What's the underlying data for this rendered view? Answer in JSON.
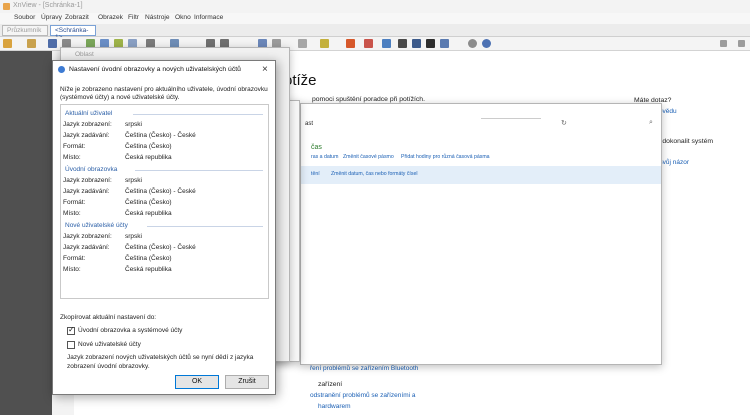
{
  "app": {
    "title": "XnView - [Schránka-1]"
  },
  "menu": [
    "Soubor",
    "Úpravy",
    "Zobrazit",
    "Obrazek",
    "Filtr",
    "Nástroje",
    "Okno",
    "Informace"
  ],
  "tabs": [
    "Průzkumník",
    "<Schránka-1>"
  ],
  "behind": {
    "heading": "otíže",
    "subtitle": "pomoci spuštění poradce při potížích.",
    "question": "Máte dotaz?",
    "help_link": "nápovědu",
    "improve": "zdokonalit systém",
    "feedback_link": "n svůj názor",
    "inner_label_1": "čas",
    "inner_links_1": [
      "ras a datum",
      "Změnit časové pásmo",
      "Přidat hodiny pro různá časová pásma"
    ],
    "inner_links_2": [
      "tění",
      "Změnit datum, čas nebo formáty čísel"
    ],
    "bottom_1": "ření problémů se zařízením Bluetooth",
    "bottom_2": "zařízení",
    "bottom_3": "odstranění problémů se zařízeními a",
    "bottom_4": "hardwarem",
    "mid_dialog_label": "ast",
    "hidden_title": "Oblast"
  },
  "dialog": {
    "title": "Nastavení úvodní obrazovky a nových uživatelských účtů",
    "intro": "Níže je zobrazeno nastavení pro aktuálního uživatele, úvodní obrazovku (systémové účty) a nové uživatelské účty.",
    "sections": [
      {
        "name": "Aktuální uživatel",
        "rows": [
          {
            "label": "Jazyk zobrazení:",
            "value": "srpski"
          },
          {
            "label": "Jazyk zadávání:",
            "value": "Čeština (Česko) - České"
          },
          {
            "label": "Formát:",
            "value": "Čeština (Česko)"
          },
          {
            "label": "Místo:",
            "value": "Česká republika"
          }
        ]
      },
      {
        "name": "Úvodní obrazovka",
        "rows": [
          {
            "label": "Jazyk zobrazení:",
            "value": "srpski"
          },
          {
            "label": "Jazyk zadávání:",
            "value": "Čeština (Česko) - České"
          },
          {
            "label": "Formát:",
            "value": "Čeština (Česko)"
          },
          {
            "label": "Místo:",
            "value": "Česká republika"
          }
        ]
      },
      {
        "name": "Nové uživatelské účty",
        "rows": [
          {
            "label": "Jazyk zobrazení:",
            "value": "srpski"
          },
          {
            "label": "Jazyk zadávání:",
            "value": "Čeština (Česko) - České"
          },
          {
            "label": "Formát:",
            "value": "Čeština (Česko)"
          },
          {
            "label": "Místo:",
            "value": "Česká republika"
          }
        ]
      }
    ],
    "copy_label": "Zkopírovat aktuální nastavení do:",
    "check_welcome": "Úvodní obrazovka a systémové účty",
    "check_welcome_checked": true,
    "check_new": "Nové uživatelské účty",
    "check_new_checked": false,
    "note": "Jazyk zobrazení nových uživatelských účtů se nyní dědí z jazyka zobrazení úvodní obrazovky.",
    "ok": "OK",
    "cancel": "Zrušit",
    "close": "×"
  },
  "colors": {
    "accent": "#0078d7",
    "section": "#2b5fa7",
    "link": "#1a5fb4"
  }
}
